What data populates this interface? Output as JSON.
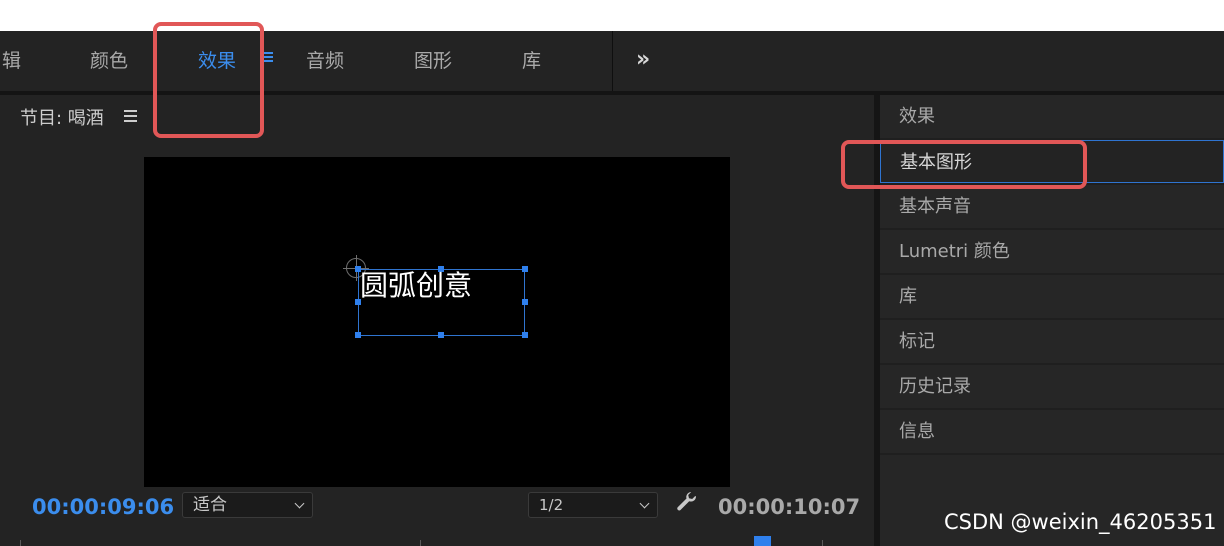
{
  "workspace_tabs": [
    {
      "label": "辑"
    },
    {
      "label": "颜色"
    },
    {
      "label": "效果"
    },
    {
      "label": "音频"
    },
    {
      "label": "图形"
    },
    {
      "label": "库"
    }
  ],
  "workspace_overflow_icon": "chevron-double-right-icon",
  "monitor": {
    "title": "节目: 喝酒",
    "overlay_text": "圆弧创意",
    "current_timecode": "00:00:09:06",
    "fit_option": "适合",
    "resolution_option": "1/2",
    "duration_timecode": "00:00:10:07",
    "settings_icon": "wrench-icon"
  },
  "panel": {
    "items": [
      {
        "label": "效果"
      },
      {
        "label": "基本图形"
      },
      {
        "label": "基本声音"
      },
      {
        "label": "Lumetri 颜色"
      },
      {
        "label": "库"
      },
      {
        "label": "标记"
      },
      {
        "label": "历史记录"
      },
      {
        "label": "信息"
      }
    ],
    "selected_index": 1
  },
  "watermark": "CSDN @weixin_46205351",
  "colors": {
    "accent": "#3b8ded",
    "highlight_annotation": "#e15757",
    "background": "#232323"
  }
}
